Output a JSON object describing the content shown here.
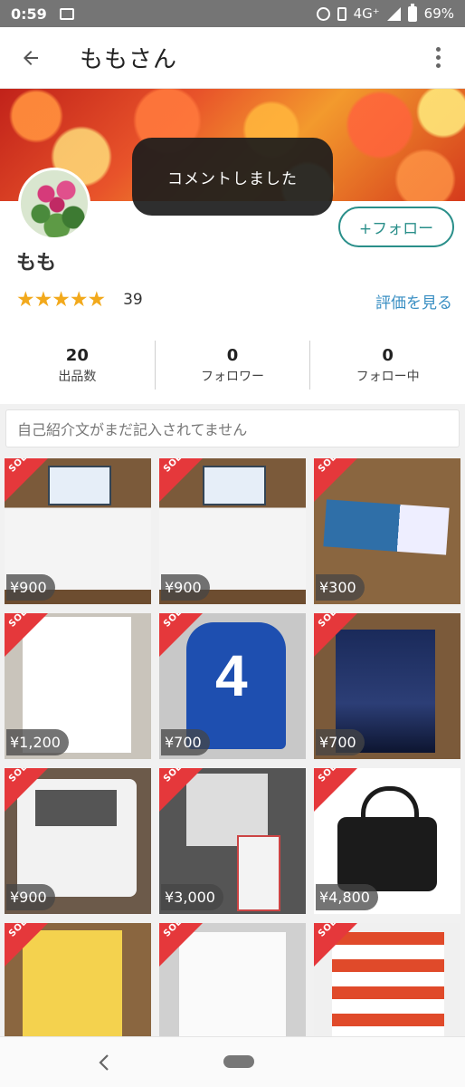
{
  "status_bar": {
    "time": "0:59",
    "network": "4G⁺",
    "battery": "69%",
    "icons": [
      "image-icon",
      "alarm-icon",
      "vibrate-icon",
      "signal-icon",
      "battery-icon"
    ]
  },
  "app_bar": {
    "title": "ももさん",
    "icons": [
      "back-arrow-icon",
      "more-vertical-icon"
    ]
  },
  "toast": {
    "message": "コメントしました"
  },
  "profile": {
    "name": "もも",
    "follow_label": "+フォロー",
    "rating_stars": 5,
    "rating_count": "39",
    "see_ratings_label": "評価を見る",
    "accent_color": "#2a8f8a",
    "link_color": "#3a8fc3",
    "star_color": "#f2a91c"
  },
  "stats": [
    {
      "value": "20",
      "label": "出品数"
    },
    {
      "value": "0",
      "label": "フォロワー"
    },
    {
      "value": "0",
      "label": "フォロー中"
    }
  ],
  "bio": {
    "placeholder": "自己紹介文がまだ記入されてません"
  },
  "items": [
    {
      "price": "¥900",
      "sold": "SOLD",
      "photo": "mask-box"
    },
    {
      "price": "¥900",
      "sold": "SOLD",
      "photo": "mask-box"
    },
    {
      "price": "¥300",
      "sold": "SOLD",
      "photo": "aquarium-coupon"
    },
    {
      "price": "¥1,200",
      "sold": "SOLD",
      "photo": "exercise-book"
    },
    {
      "price": "¥700",
      "sold": "SOLD",
      "photo": "number-vest"
    },
    {
      "price": "¥700",
      "sold": "SOLD",
      "photo": "night-sky-book"
    },
    {
      "price": "¥900",
      "sold": "SOLD",
      "photo": "makeup-palette"
    },
    {
      "price": "¥3,000",
      "sold": "SOLD",
      "photo": "phone-set"
    },
    {
      "price": "¥4,800",
      "sold": "SOLD",
      "photo": "black-handbag"
    },
    {
      "price": "",
      "sold": "SOLD",
      "photo": "parenting-book"
    },
    {
      "price": "",
      "sold": "SOLD",
      "photo": "baby-massage-book"
    },
    {
      "price": "",
      "sold": "SOLD",
      "photo": "bowling-tickets"
    }
  ],
  "nav_bar": {
    "icons": [
      "nav-back-icon",
      "home-pill-icon"
    ]
  }
}
